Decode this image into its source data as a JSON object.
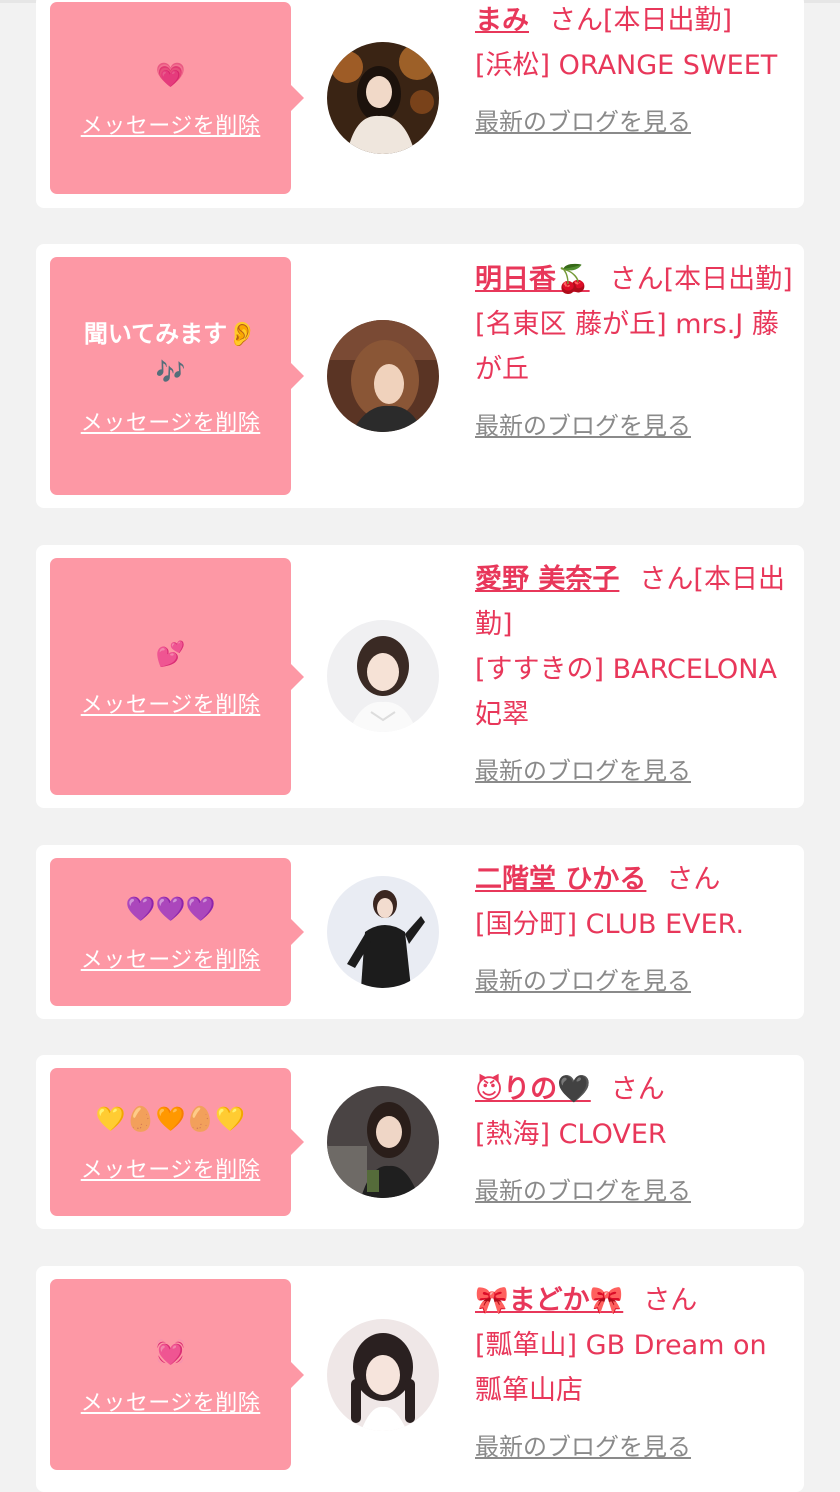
{
  "delete_label": "メッセージを削除",
  "blog_label": "最新のブログを見る",
  "accent_color": "#e8375a",
  "bubble_color": "#fd98a5",
  "messages": [
    {
      "message": "💗",
      "name": "まみ",
      "suffix": "さん[本日出勤]",
      "shop": "[浜松] ORANGE SWEET",
      "avatar": "photo-mami"
    },
    {
      "message": "聞いてみます👂\n🎶",
      "name": "明日香🍒",
      "suffix": "さん[本日出勤]",
      "shop": "[名東区 藤が丘] mrs.J 藤が丘",
      "avatar": "photo-asuka"
    },
    {
      "message": "💕",
      "name": "愛野 美奈子",
      "suffix": "さん[本日出勤]",
      "shop": "[すすきの] BARCELONA 妃翠",
      "avatar": "photo-minako"
    },
    {
      "message": "💜💜💜",
      "name": "二階堂 ひかる",
      "suffix": "さん",
      "shop": "[国分町] CLUB EVER.",
      "avatar": "photo-hikaru"
    },
    {
      "message": "💛🥚🧡🥚💛",
      "name": "😈りの🖤",
      "suffix": "さん",
      "shop": "[熱海] CLOVER",
      "avatar": "photo-rino"
    },
    {
      "message": "💓",
      "name": "🎀まどか🎀",
      "suffix": "さん",
      "shop": "[瓢箪山] GB Dream on　瓢箪山店",
      "avatar": "photo-madoka"
    }
  ]
}
